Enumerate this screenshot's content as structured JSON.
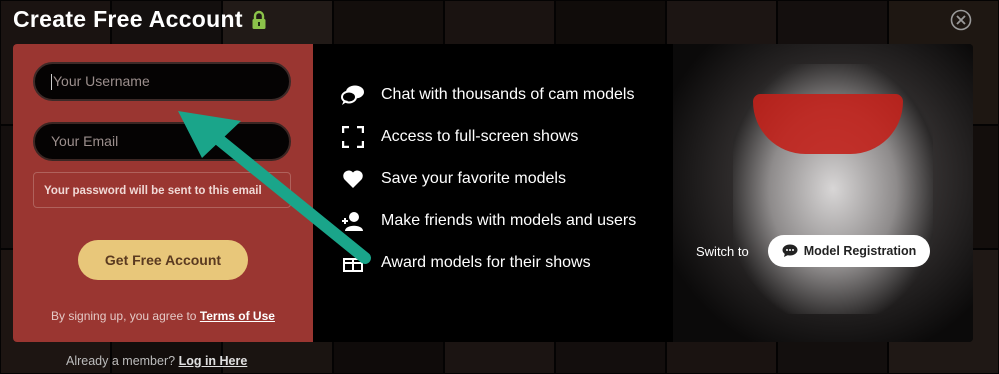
{
  "page": {
    "title": "Create Free Account",
    "lock_icon": "lock-icon",
    "close_icon": "close-circle-icon"
  },
  "form": {
    "username_placeholder": "Your Username",
    "email_placeholder": "Your Email",
    "password_hint": "Your password will be sent to this email",
    "submit_label": "Get Free Account",
    "terms_prefix": "By signing up, you agree to",
    "terms_link": "Terms of Use"
  },
  "features": [
    {
      "icon": "chat-bubbles-icon",
      "label": "Chat with thousands of cam models"
    },
    {
      "icon": "fullscreen-icon",
      "label": "Access to full-screen shows"
    },
    {
      "icon": "heart-icon",
      "label": "Save your favorite models"
    },
    {
      "icon": "add-friend-icon",
      "label": "Make friends with models and users"
    },
    {
      "icon": "award-icon",
      "label": "Award models for their shows"
    }
  ],
  "switch": {
    "label": "Switch to",
    "button_label": "Model Registration",
    "button_icon": "chat-icon"
  },
  "footer": {
    "already_member": "Already a member?",
    "login_link": "Log in Here"
  },
  "colors": {
    "form_panel": "#9a3631",
    "submit": "#e8c77a",
    "lock": "#8bc34a",
    "annotation_arrow": "#1aa58a"
  }
}
